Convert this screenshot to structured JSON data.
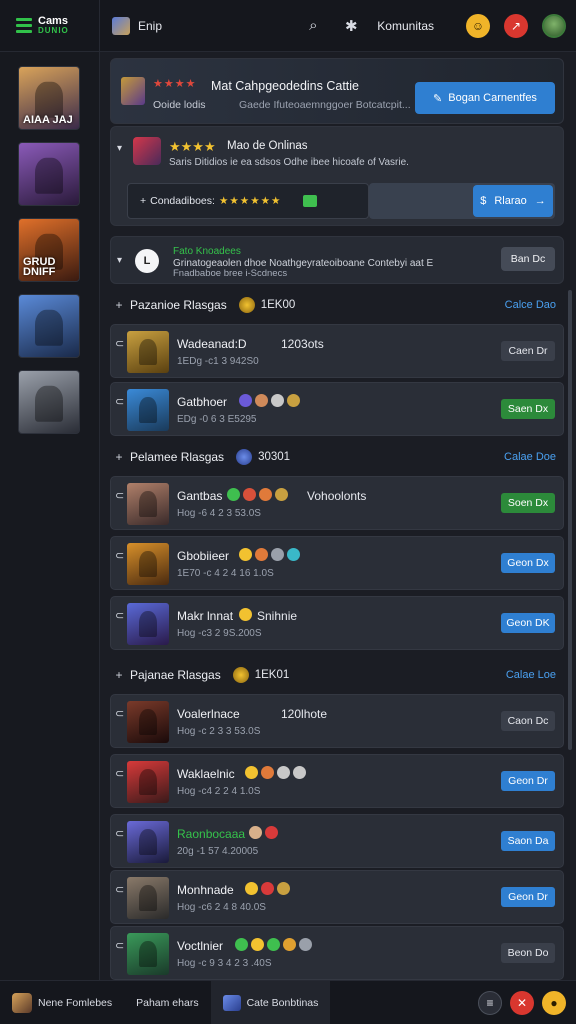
{
  "app": {
    "logo_line1": "Cams",
    "logo_line2": "DUNIO",
    "page_title": "Enip",
    "community_label": "Komunitas"
  },
  "icons": {
    "menu": "hamburger-menu-icon",
    "search": "search-icon",
    "settings": "sparkle-icon",
    "notif": "emoji-icon",
    "alert": "alert-icon"
  },
  "sidebar": {
    "thumbs": [
      {
        "label": "AIAA JAJ",
        "c1": "#d9a35a",
        "c2": "#3a2a4a"
      },
      {
        "label": "",
        "c1": "#8a5ab8",
        "c2": "#2a1a3a"
      },
      {
        "label": "GRUD DNIFF",
        "c1": "#e0702a",
        "c2": "#3a1a10"
      },
      {
        "label": "",
        "c1": "#5a8ad8",
        "c2": "#1a2a4a"
      },
      {
        "label": "",
        "c1": "#9aa0aa",
        "c2": "#2a2d36"
      }
    ]
  },
  "hero": {
    "stars": "★★★★",
    "title": "Mat Cahpgeodedins Cattie",
    "sub1": "Ooide lodis",
    "sub2": "Gaede Ifuteoaemnggoer Botcatcpit...",
    "cta": "Bogan Carnentfes"
  },
  "live": {
    "stars": "★★★★",
    "title": "Mao de Onlinas",
    "desc": "Saris Ditidios ie ea sdsos Odhe ibee hicoafe of Vasrie.",
    "bar_label": "Condadiboes:",
    "bar_stars": "★★★★★★",
    "button": "Rlarao"
  },
  "notice": {
    "title": "Fato Knoadees",
    "line1": "Grinatogeaolen dhoe Noathgeyrateoiboane Contebyi aat E",
    "line2": "Fnadbaboe bree i-Scdnecs",
    "button": "Ban Dc"
  },
  "sections": [
    {
      "title": "Pazanioe Rlasgas",
      "count": "1EK00",
      "link": "Calce Dao"
    },
    {
      "title": "Pelamee Rlasgas",
      "count": "30301",
      "link": "Calae Doe"
    },
    {
      "title": "Pajanae Rlasgas",
      "count": "1EK01",
      "link": "Calae Loe"
    }
  ],
  "rows": [
    {
      "name": "Wadeanad:D",
      "extra": "1203ots",
      "meta": "1EDg -c1 3 942S0",
      "button": "Caen Dr",
      "btn_style": "gray",
      "c1": "#c8a040",
      "c2": "#5a4010"
    },
    {
      "name": "Gatbhoer",
      "extra": "",
      "meta": "EDg -0 6 3 E5295",
      "button": "Saen Dx",
      "btn_style": "green",
      "c1": "#3a8ad8",
      "c2": "#1a3a5a"
    },
    {
      "name": "Gantbas",
      "extra": "Vohoolonts",
      "meta": "Hog -6 4 2 3 53.0S",
      "button": "Soen Dx",
      "btn_style": "green",
      "c1": "#b0806a",
      "c2": "#3a2a2a"
    },
    {
      "name": "Gbobiieer",
      "extra": "",
      "meta": "1E70 -c 4 2 4 16 1.0S",
      "button": "Geon Dx",
      "btn_style": "blue",
      "c1": "#d8902a",
      "c2": "#4a2a10"
    },
    {
      "name": "Makr lnnat",
      "extra": "Snihnie",
      "meta": "Hog -c3 2 9S.200S",
      "button": "Geon DK",
      "btn_style": "blue",
      "c1": "#5a6ad8",
      "c2": "#2a1a4a"
    },
    {
      "name": "Voalerlnace",
      "extra": "120lhote",
      "meta": "Hog -c 2 3 3 53.0S",
      "button": "Caon Dc",
      "btn_style": "gray",
      "c1": "#7a3a2a",
      "c2": "#1a0a0a"
    },
    {
      "name": "Waklaelnic",
      "extra": "",
      "meta": "Hog -c4 2 2 4 1.0S",
      "button": "Geon Dr",
      "btn_style": "blue",
      "c1": "#d83a3a",
      "c2": "#3a1a1a"
    },
    {
      "name": "Raonbocaaa",
      "extra": "",
      "meta": "20g -1 57 4.20005",
      "button": "Saon Da",
      "btn_style": "blue",
      "c1": "#6a6ad8",
      "c2": "#1a1a3a",
      "green": true
    },
    {
      "name": "Monhnade",
      "extra": "",
      "meta": "Hog -c6 2 4 8 40.0S",
      "button": "Geon Dr",
      "btn_style": "blue",
      "c1": "#8a7a6a",
      "c2": "#2a2a2a"
    },
    {
      "name": "Voctlnier",
      "extra": "",
      "meta": "Hog -c 9 3 4 2 3 .40S",
      "button": "Beon Do",
      "btn_style": "gray",
      "c1": "#3a9a5a",
      "c2": "#1a3a2a"
    }
  ],
  "bottom": {
    "nav1": "Nene Fomlebes",
    "nav2": "Paham ehars",
    "nav3": "Cate Bonbtinas"
  },
  "colors": {
    "accent_blue": "#2f7fd1",
    "accent_green": "#31c24a",
    "bg": "#1b1d24"
  }
}
